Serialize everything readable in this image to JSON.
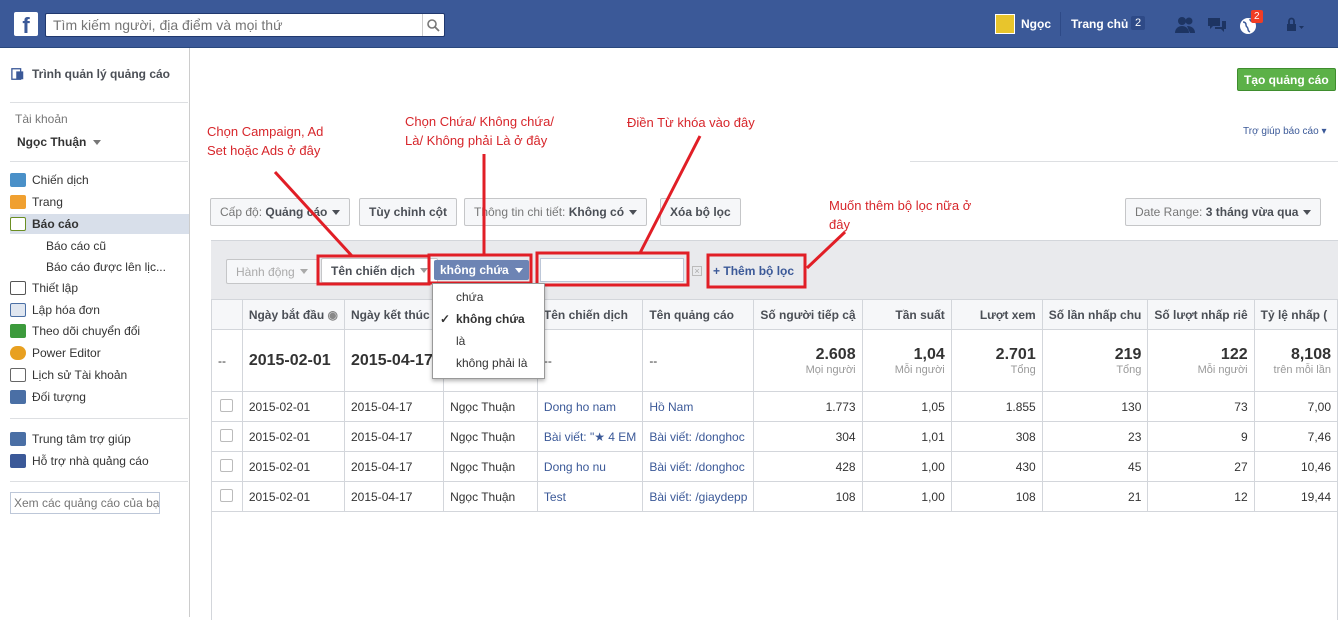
{
  "topbar": {
    "logo": "f",
    "search_placeholder": "Tìm kiếm người, địa điểm và mọi thứ",
    "user": "Ngọc",
    "home": "Trang chủ",
    "home_count": "2",
    "notif_count": "2"
  },
  "sidebar": {
    "app_title": "Trình quản lý quảng cáo",
    "account_label": "Tài khoản",
    "account_name": "Ngọc Thuận",
    "nav": [
      {
        "label": "Chiến dịch",
        "color": "#4a90c8"
      },
      {
        "label": "Trang",
        "color": "#f0a030"
      },
      {
        "label": "Báo cáo",
        "color": "#6b8e23"
      }
    ],
    "sub": [
      "Báo cáo cũ",
      "Báo cáo được lên lịc..."
    ],
    "nav2": [
      {
        "label": "Thiết lập",
        "color": "#555"
      },
      {
        "label": "Lập hóa đơn",
        "color": "#4a6fa5"
      },
      {
        "label": "Theo dõi chuyển đổi",
        "color": "#3c9a3c"
      },
      {
        "label": "Power Editor",
        "color": "#e8a020"
      },
      {
        "label": "Lịch sử Tài khoản",
        "color": "#666"
      },
      {
        "label": "Đối tượng",
        "color": "#4a6fa5"
      }
    ],
    "nav3": [
      {
        "label": "Trung tâm trợ giúp",
        "color": "#4a6fa5"
      },
      {
        "label": "Hỗ trợ nhà quảng cáo",
        "color": "#3b5998"
      }
    ],
    "search_placeholder": "Xem các quảng cáo của bạ"
  },
  "header": {
    "create_button": "Tạo quảng cáo",
    "help_link": "Trợ giúp báo cáo ▾"
  },
  "toolbar": {
    "level_label": "Cấp độ:",
    "level_value": "Quảng cáo",
    "customize": "Tùy chỉnh cột",
    "detail_label": "Thông tin chi tiết:",
    "detail_value": "Không có",
    "clear": "Xóa bộ lọc",
    "date_label": "Date Range:",
    "date_value": "3 tháng vừa qua"
  },
  "filter": {
    "action": "Hành động",
    "field": "Tên chiến dịch",
    "operator": "không chứa",
    "add": "Thêm bộ lọc",
    "add_icon": "+"
  },
  "dropdown": {
    "options": [
      "chứa",
      "không chứa",
      "là",
      "không phải là"
    ],
    "selected": 1,
    "check": "✓"
  },
  "annotations": {
    "a1": "Chọn Campaign, Ad Set hoặc Ads ở đây",
    "a2": "Chọn Chứa/ Không chứa/ Là/ Không phải Là ở đây",
    "a3": "Điền Từ khóa vào đây",
    "a4": "Muốn thêm bộ lọc nữa ở đây"
  },
  "table": {
    "columns": [
      "Ngày bắt đầu",
      "Ngày kết thúc",
      "",
      "Tên chiến dịch",
      "Tên quảng cáo",
      "Số người tiếp cậ",
      "Tần suất",
      "Lượt xem",
      "Số lần nhấp chu",
      "Số lượt nhấp riê",
      "Tỷ lệ nhấp ("
    ],
    "summary": {
      "dash": "--",
      "start": "2015-02-01",
      "end": "2015-04-17",
      "camp": "--",
      "ad": "--",
      "reach": "2.608",
      "reach_sub": "Mọi người",
      "freq": "1,04",
      "freq_sub": "Mỗi người",
      "views": "2.701",
      "views_sub": "Tổng",
      "clicks": "219",
      "clicks_sub": "Tổng",
      "uclicks": "122",
      "uclicks_sub": "Mỗi người",
      "ctr": "8,108",
      "ctr_sub": "trên mỗi lần"
    },
    "rows": [
      {
        "start": "2015-02-01",
        "end": "2015-04-17",
        "acct": "Ngọc Thuận",
        "camp": "Dong ho nam",
        "ad": "Hồ Nam",
        "reach": "1.773",
        "freq": "1,05",
        "views": "1.855",
        "clicks": "130",
        "uclicks": "73",
        "ctr": "7,00"
      },
      {
        "start": "2015-02-01",
        "end": "2015-04-17",
        "acct": "Ngọc Thuận",
        "camp": "Bài viết: \"★ 4 EM",
        "ad": "Bài viết: /donghoc",
        "reach": "304",
        "freq": "1,01",
        "views": "308",
        "clicks": "23",
        "uclicks": "9",
        "ctr": "7,46"
      },
      {
        "start": "2015-02-01",
        "end": "2015-04-17",
        "acct": "Ngọc Thuận",
        "camp": "Dong ho nu",
        "ad": "Bài viết: /donghoc",
        "reach": "428",
        "freq": "1,00",
        "views": "430",
        "clicks": "45",
        "uclicks": "27",
        "ctr": "10,46"
      },
      {
        "start": "2015-02-01",
        "end": "2015-04-17",
        "acct": "Ngọc Thuận",
        "camp": "Test",
        "ad": "Bài viết: /giaydepp",
        "reach": "108",
        "freq": "1,00",
        "views": "108",
        "clicks": "21",
        "uclicks": "12",
        "ctr": "19,44"
      }
    ]
  }
}
